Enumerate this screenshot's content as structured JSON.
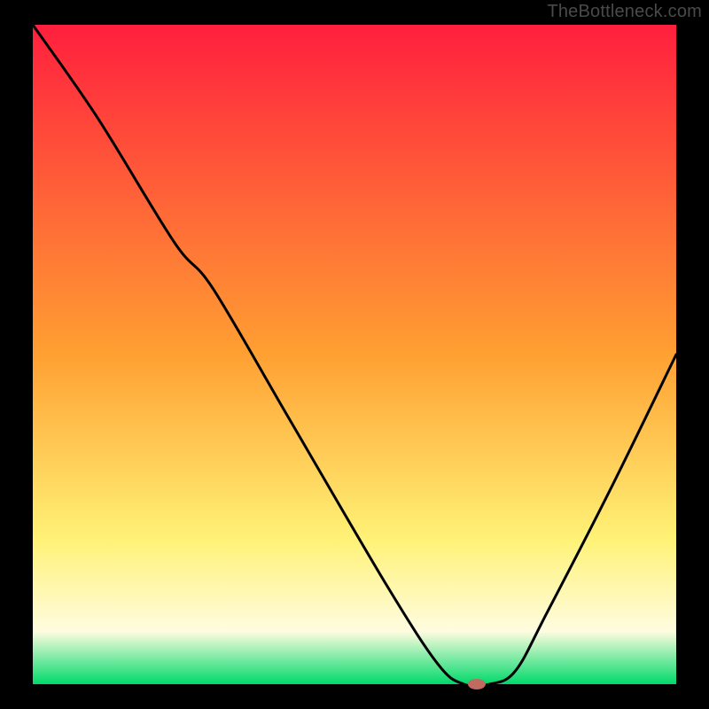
{
  "watermark": "TheBottleneck.com",
  "colors": {
    "black": "#000000",
    "gradient_top": "#ff1f3e",
    "gradient_band_start": "#fff276",
    "gradient_band_end": "#fffce0",
    "gradient_bottom": "#00d96a",
    "line": "#000000",
    "marker": "#c06a60"
  },
  "layout": {
    "left_margin": 37,
    "right_margin": 37,
    "top_margin": 28,
    "bottom_margin": 28
  },
  "chart_data": {
    "type": "line",
    "title": "",
    "xlabel": "",
    "ylabel": "",
    "xlim": [
      0,
      100
    ],
    "ylim": [
      0,
      100
    ],
    "series": [
      {
        "name": "bottleneck-curve",
        "x": [
          0,
          10,
          22,
          28,
          40,
          55,
          63,
          67,
          71,
          75,
          80,
          90,
          100
        ],
        "values": [
          100,
          86,
          67,
          60,
          40,
          15,
          3,
          0,
          0,
          2,
          11,
          30,
          50
        ]
      }
    ],
    "marker": {
      "x": 69,
      "y": 0,
      "rx": 10,
      "ry": 6
    }
  }
}
